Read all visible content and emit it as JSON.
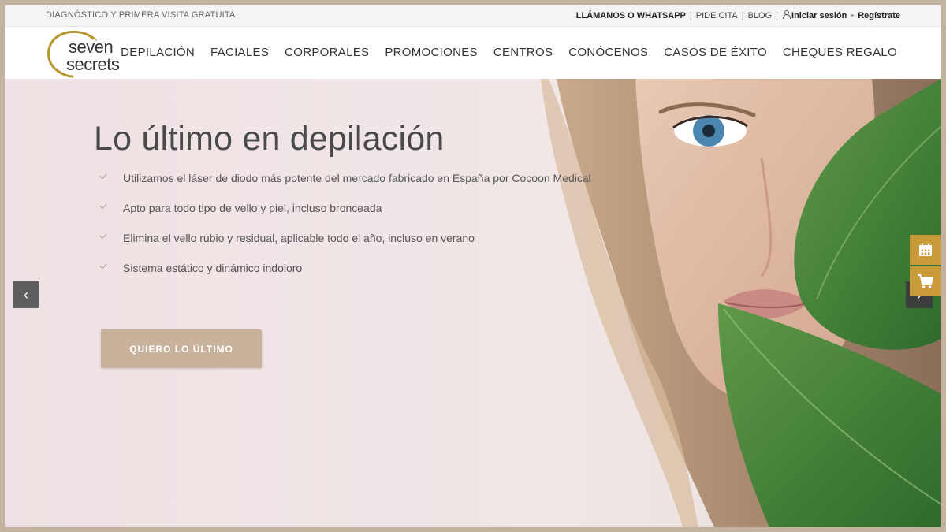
{
  "topbar": {
    "promo": "DIAGNÓSTICO Y PRIMERA VISITA GRATUITA",
    "call": "LLÁMANOS O WHATSAPP",
    "appointment": "PIDE CITA",
    "blog": "BLOG",
    "login": "Iniciar sesión",
    "dot": "•",
    "register": "Regístrate",
    "separator": "|"
  },
  "logo": {
    "line1": "seven",
    "line2": "secrets",
    "ring_color": "#b8962e"
  },
  "nav": [
    {
      "label": "DEPILACIÓN"
    },
    {
      "label": "FACIALES"
    },
    {
      "label": "CORPORALES"
    },
    {
      "label": "PROMOCIONES"
    },
    {
      "label": "CENTROS"
    },
    {
      "label": "CONÓCENOS"
    },
    {
      "label": "CASOS DE ÉXITO"
    },
    {
      "label": "CHEQUES REGALO"
    }
  ],
  "hero": {
    "title": "Lo último en depilación",
    "bullets": [
      "Utilizamos el láser de diodo más potente del mercado fabricado en España por Cocoon Medical",
      "Apto para todo tipo de vello y piel, incluso bronceada",
      "Elimina el vello rubio y residual, aplicable todo el año, incluso en verano",
      "Sistema estático y dinámico indoloro"
    ],
    "cta": "QUIERO LO ÚLTIMO",
    "prev_glyph": "‹",
    "next_glyph": "›"
  },
  "colors": {
    "accent": "#c8b29c",
    "side_tab": "#c89a38",
    "frame": "#c3b29d"
  },
  "icons": {
    "check": "check-icon",
    "calendar": "calendar-icon",
    "cart": "cart-icon",
    "user": "user-icon"
  }
}
